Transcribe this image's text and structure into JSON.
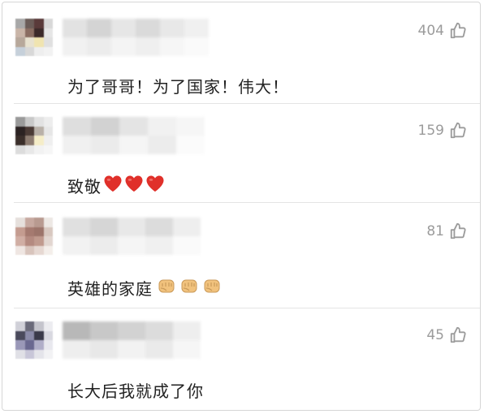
{
  "comments": [
    {
      "likes": "404",
      "text": "为了哥哥！为了国家！伟大！",
      "emoji": []
    },
    {
      "likes": "159",
      "text": "致敬",
      "emoji": [
        "heart-icon",
        "heart-icon",
        "heart-icon"
      ]
    },
    {
      "likes": "81",
      "text": "英雄的家庭",
      "emoji": [
        "fist-icon",
        "fist-icon",
        "fist-icon"
      ]
    },
    {
      "likes": "45",
      "text": "长大后我就成了你",
      "emoji": []
    }
  ],
  "colors": {
    "heart": "#e0302a",
    "fist": "#f1c27d",
    "like_gray": "#9b9b9b",
    "divider": "#e4e4e4"
  }
}
